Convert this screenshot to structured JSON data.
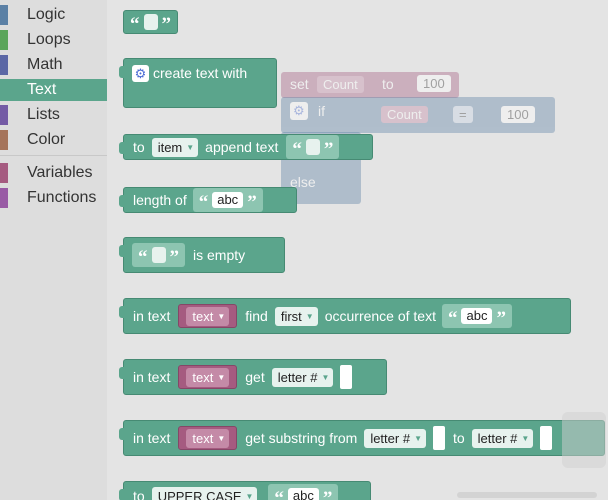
{
  "toolbox": {
    "categories": [
      {
        "label": "Logic",
        "color": "#5b80a5"
      },
      {
        "label": "Loops",
        "color": "#5ba55b"
      },
      {
        "label": "Math",
        "color": "#5b67a5"
      },
      {
        "label": "Text",
        "color": "#5ba58c",
        "selected": true
      },
      {
        "label": "Lists",
        "color": "#745ba5"
      },
      {
        "label": "Color",
        "color": "#a5745b"
      },
      {
        "label": "Variables",
        "color": "#a55b80"
      },
      {
        "label": "Functions",
        "color": "#995ba5"
      }
    ]
  },
  "background": {
    "set_label": "set",
    "count_dd": "Count",
    "to_label": "to",
    "num1": "100",
    "if_label": "if",
    "count_dd2": "Count",
    "eq_dd": "=",
    "num2": "100",
    "else_label": "else"
  },
  "blocks": {
    "create_text": {
      "label": "create text with"
    },
    "append": {
      "to": "to",
      "var": "item",
      "label": "append text"
    },
    "length": {
      "label": "length of",
      "value": "abc"
    },
    "is_empty": {
      "label": "is empty"
    },
    "find": {
      "in_text": "in text",
      "var": "text",
      "find": "find",
      "mode": "first",
      "occ": "occurrence of text",
      "value": "abc"
    },
    "get_letter": {
      "in_text": "in text",
      "var": "text",
      "get": "get",
      "mode": "letter #"
    },
    "substring": {
      "in_text": "in text",
      "var": "text",
      "get": "get substring from",
      "from_mode": "letter #",
      "to": "to",
      "to_mode": "letter #"
    },
    "change_case": {
      "to": "to",
      "mode": "UPPER CASE",
      "value": "abc"
    }
  }
}
